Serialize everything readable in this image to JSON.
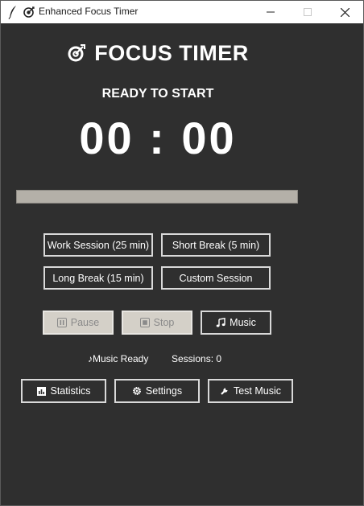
{
  "window": {
    "title": "Enhanced Focus Timer",
    "controls": [
      "minimize",
      "maximize",
      "close"
    ]
  },
  "header": {
    "title": "FOCUS TIMER",
    "icon": "target-dart-icon"
  },
  "status": {
    "text": "READY TO START"
  },
  "timer": {
    "display": "00 : 00"
  },
  "progress": {
    "value": 0
  },
  "sessions": {
    "work": "Work Session (25 min)",
    "short_break": "Short Break (5 min)",
    "long_break": "Long Break (15 min)",
    "custom": "Custom Session"
  },
  "controls": {
    "pause": "Pause",
    "stop": "Stop",
    "music": "Music"
  },
  "info": {
    "music_status": "Music Ready",
    "sessions": "Sessions: 0"
  },
  "footer": {
    "statistics": "Statistics",
    "settings": "Settings",
    "test_music": "Test Music"
  },
  "colors": {
    "background": "#2f2f2f",
    "progress_trough": "#b4b0a8",
    "button_border": "#d9d9d9",
    "disabled_bg": "#d4d0c8"
  }
}
